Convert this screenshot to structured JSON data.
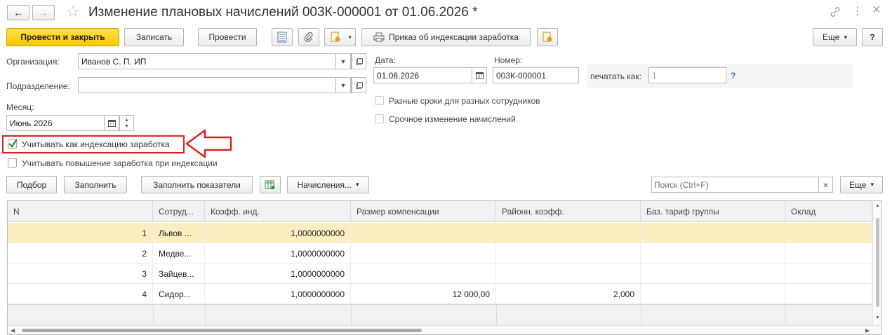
{
  "window": {
    "title": "Изменение плановых начислений 003К-000001 от 01.06.2026 *",
    "nav_back": "←",
    "nav_forward": "→",
    "star_icon": "☆",
    "link_icon": "🔗",
    "menu_icon": "⋮",
    "close_icon": "×"
  },
  "toolbar": {
    "post_close": "Провести и закрыть",
    "save": "Записать",
    "post": "Провести",
    "order_index": "Приказ об индексации заработка",
    "more": "Еще",
    "more_arrow": "▾",
    "help": "?"
  },
  "form": {
    "org_label": "Организация:",
    "org_value": "Иванов С. П. ИП",
    "dept_label": "Подразделение:",
    "dept_value": "",
    "month_label": "Месяц:",
    "month_value": "Июнь 2026",
    "date_label": "Дата:",
    "date_value": "01.06.2026",
    "number_label": "Номер:",
    "number_value": "003К-000001",
    "print_as_label": "печатать как:",
    "print_as_value": "1",
    "print_help": "?",
    "chk_diff_dates": "Разные сроки для разных сотрудников",
    "chk_urgent": "Срочное изменение начислений",
    "chk_index": "Учитывать как индексацию заработка",
    "chk_raise": "Учитывать повышение заработка при индексации"
  },
  "table_toolbar": {
    "pick": "Подбор",
    "fill": "Заполнить",
    "fill_indicators": "Заполнить показатели",
    "accruals": "Начисления...",
    "search_placeholder": "Поиск (Ctrl+F)",
    "clear": "×",
    "more": "Еще"
  },
  "table": {
    "columns": [
      "N",
      "Сотруд...",
      "Коэфф. инд.",
      "Размер компенсации",
      "Районн. коэфф.",
      "Баз. тариф группы",
      "Оклад"
    ],
    "rows": [
      {
        "n": "1",
        "employee": "Львов ...",
        "coef": "1,0000000000",
        "comp": "",
        "region": "",
        "base": "",
        "salary": ""
      },
      {
        "n": "2",
        "employee": "Медве...",
        "coef": "1,0000000000",
        "comp": "",
        "region": "",
        "base": "",
        "salary": ""
      },
      {
        "n": "3",
        "employee": "Зайцев...",
        "coef": "1,0000000000",
        "comp": "",
        "region": "",
        "base": "",
        "salary": ""
      },
      {
        "n": "4",
        "employee": "Сидор...",
        "coef": "1,0000000000",
        "comp": "12 000,00",
        "region": "2,000",
        "base": "",
        "salary": ""
      }
    ]
  },
  "colors": {
    "primary_button": "#f7c900",
    "selected_row": "#fbeec0",
    "highlight_box": "#e02020",
    "link_help": "#2a6fc0"
  }
}
